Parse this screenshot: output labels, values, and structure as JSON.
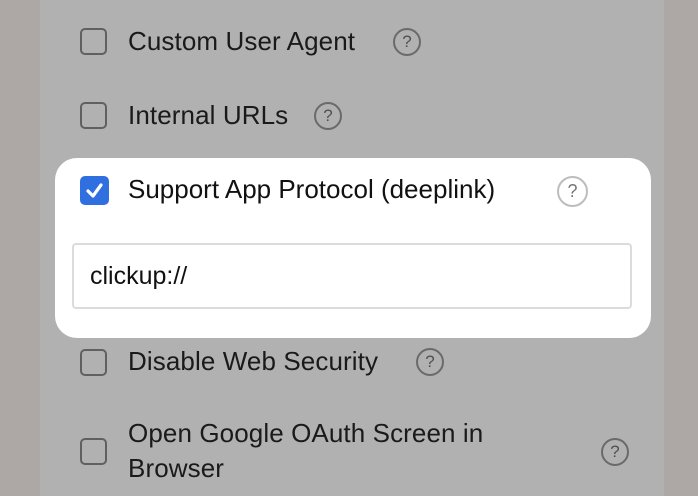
{
  "settings": {
    "custom_user_agent": {
      "label": "Custom User Agent",
      "checked": false,
      "help_icon": "question-mark"
    },
    "internal_urls": {
      "label": "Internal URLs",
      "checked": false,
      "help_icon": "question-mark"
    },
    "support_app_protocol": {
      "label": "Support App Protocol (deeplink)",
      "checked": true,
      "help_icon": "question-mark",
      "input_value": "clickup://"
    },
    "disable_web_security": {
      "label": "Disable Web Security",
      "checked": false,
      "help_icon": "question-mark"
    },
    "open_google_oauth": {
      "label_line1": "Open Google OAuth Screen in",
      "label_line2": "Browser",
      "checked": false,
      "help_icon": "question-mark"
    },
    "help_glyph": "?"
  },
  "colors": {
    "checkbox_checked": "#2f6fe0",
    "overlay": "#b1b1b1",
    "card_background": "#ffffff"
  }
}
